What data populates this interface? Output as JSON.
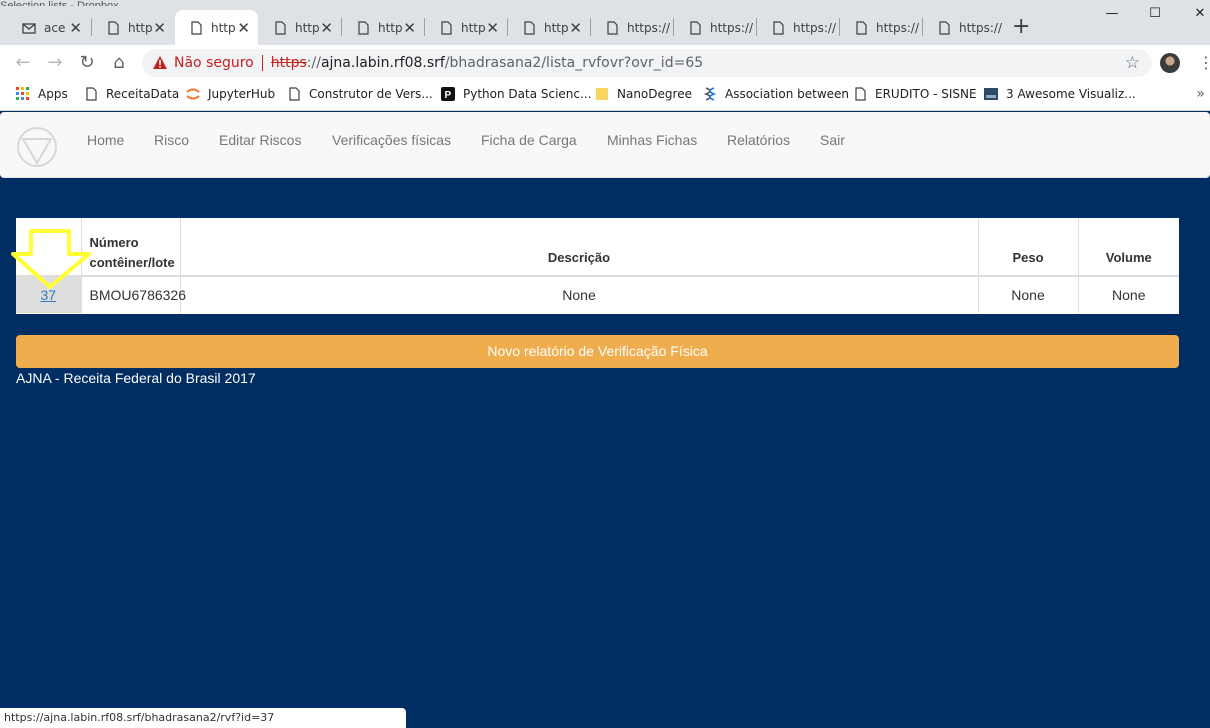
{
  "browser": {
    "partial_window_title": "Selection lists - Dropbox",
    "tabs": [
      {
        "title": "ace",
        "icon": "mail-icon",
        "active": false
      },
      {
        "title": "http",
        "icon": "page-icon",
        "active": false
      },
      {
        "title": "http",
        "icon": "page-icon",
        "active": true
      },
      {
        "title": "http",
        "icon": "page-icon",
        "active": false
      },
      {
        "title": "http",
        "icon": "page-icon",
        "active": false
      },
      {
        "title": "http",
        "icon": "page-icon",
        "active": false
      },
      {
        "title": "http",
        "icon": "page-icon",
        "active": false
      },
      {
        "title": "https://",
        "icon": "page-icon",
        "active": false
      },
      {
        "title": "https://",
        "icon": "page-icon",
        "active": false
      },
      {
        "title": "https://",
        "icon": "page-icon",
        "active": false
      },
      {
        "title": "https://",
        "icon": "page-icon",
        "active": false
      },
      {
        "title": "https://",
        "icon": "page-icon",
        "active": false
      }
    ],
    "tab_close_glyph": "✕",
    "new_tab_glyph": "+",
    "window_controls": {
      "minimize": "—",
      "maximize": "☐",
      "close": "✕"
    },
    "nav": {
      "back": "←",
      "forward": "→",
      "reload": "↻",
      "home": "⌂"
    },
    "security_label": "Não seguro",
    "url": {
      "scheme": "https",
      "rest": "://",
      "host": "ajna.labin.rf08.srf",
      "path": "/bhadrasana2/lista_rvfovr?ovr_id=65"
    },
    "star_glyph": "☆",
    "menu_glyph": "⋮",
    "bookmarks": [
      {
        "label": "Apps",
        "icon": "apps-grid-icon"
      },
      {
        "label": "ReceitaData",
        "icon": "page-icon"
      },
      {
        "label": "JupyterHub",
        "icon": "jupyter-icon"
      },
      {
        "label": "Construtor de Vers...",
        "icon": "page-icon"
      },
      {
        "label": "Python Data Scienc...",
        "icon": "p-logo-icon"
      },
      {
        "label": "NanoDegree",
        "icon": "folder-icon"
      },
      {
        "label": "Association between",
        "icon": "dna-icon"
      },
      {
        "label": "ERUDITO - SISNE",
        "icon": "page-icon"
      },
      {
        "label": "3 Awesome Visualiz...",
        "icon": "image-icon"
      }
    ],
    "bookmarks_more": "»",
    "status_url": "https://ajna.labin.rf08.srf/bhadrasana2/rvf?id=37"
  },
  "colors": {
    "page_bg": "#002d62",
    "button_orange": "#f0ad4e",
    "arrow_yellow": "#ffff33",
    "not_secure_red": "#c5221f"
  },
  "navbar": {
    "items": [
      "Home",
      "Risco",
      "Editar Riscos",
      "Verificações físicas",
      "Ficha de Carga",
      "Minhas Fichas",
      "Relatórios",
      "Sair"
    ]
  },
  "table": {
    "headers": [
      "",
      "Número contêiner/lote",
      "Descrição",
      "Peso",
      "Volume"
    ],
    "rows": [
      {
        "id": "37",
        "numero": "BMOU6786326",
        "descricao": "None",
        "peso": "None",
        "volume": "None"
      }
    ]
  },
  "actions": {
    "new_report_label": "Novo relatório de Verificação Física"
  },
  "footer": {
    "text": "AJNA - Receita Federal do Brasil 2017"
  }
}
